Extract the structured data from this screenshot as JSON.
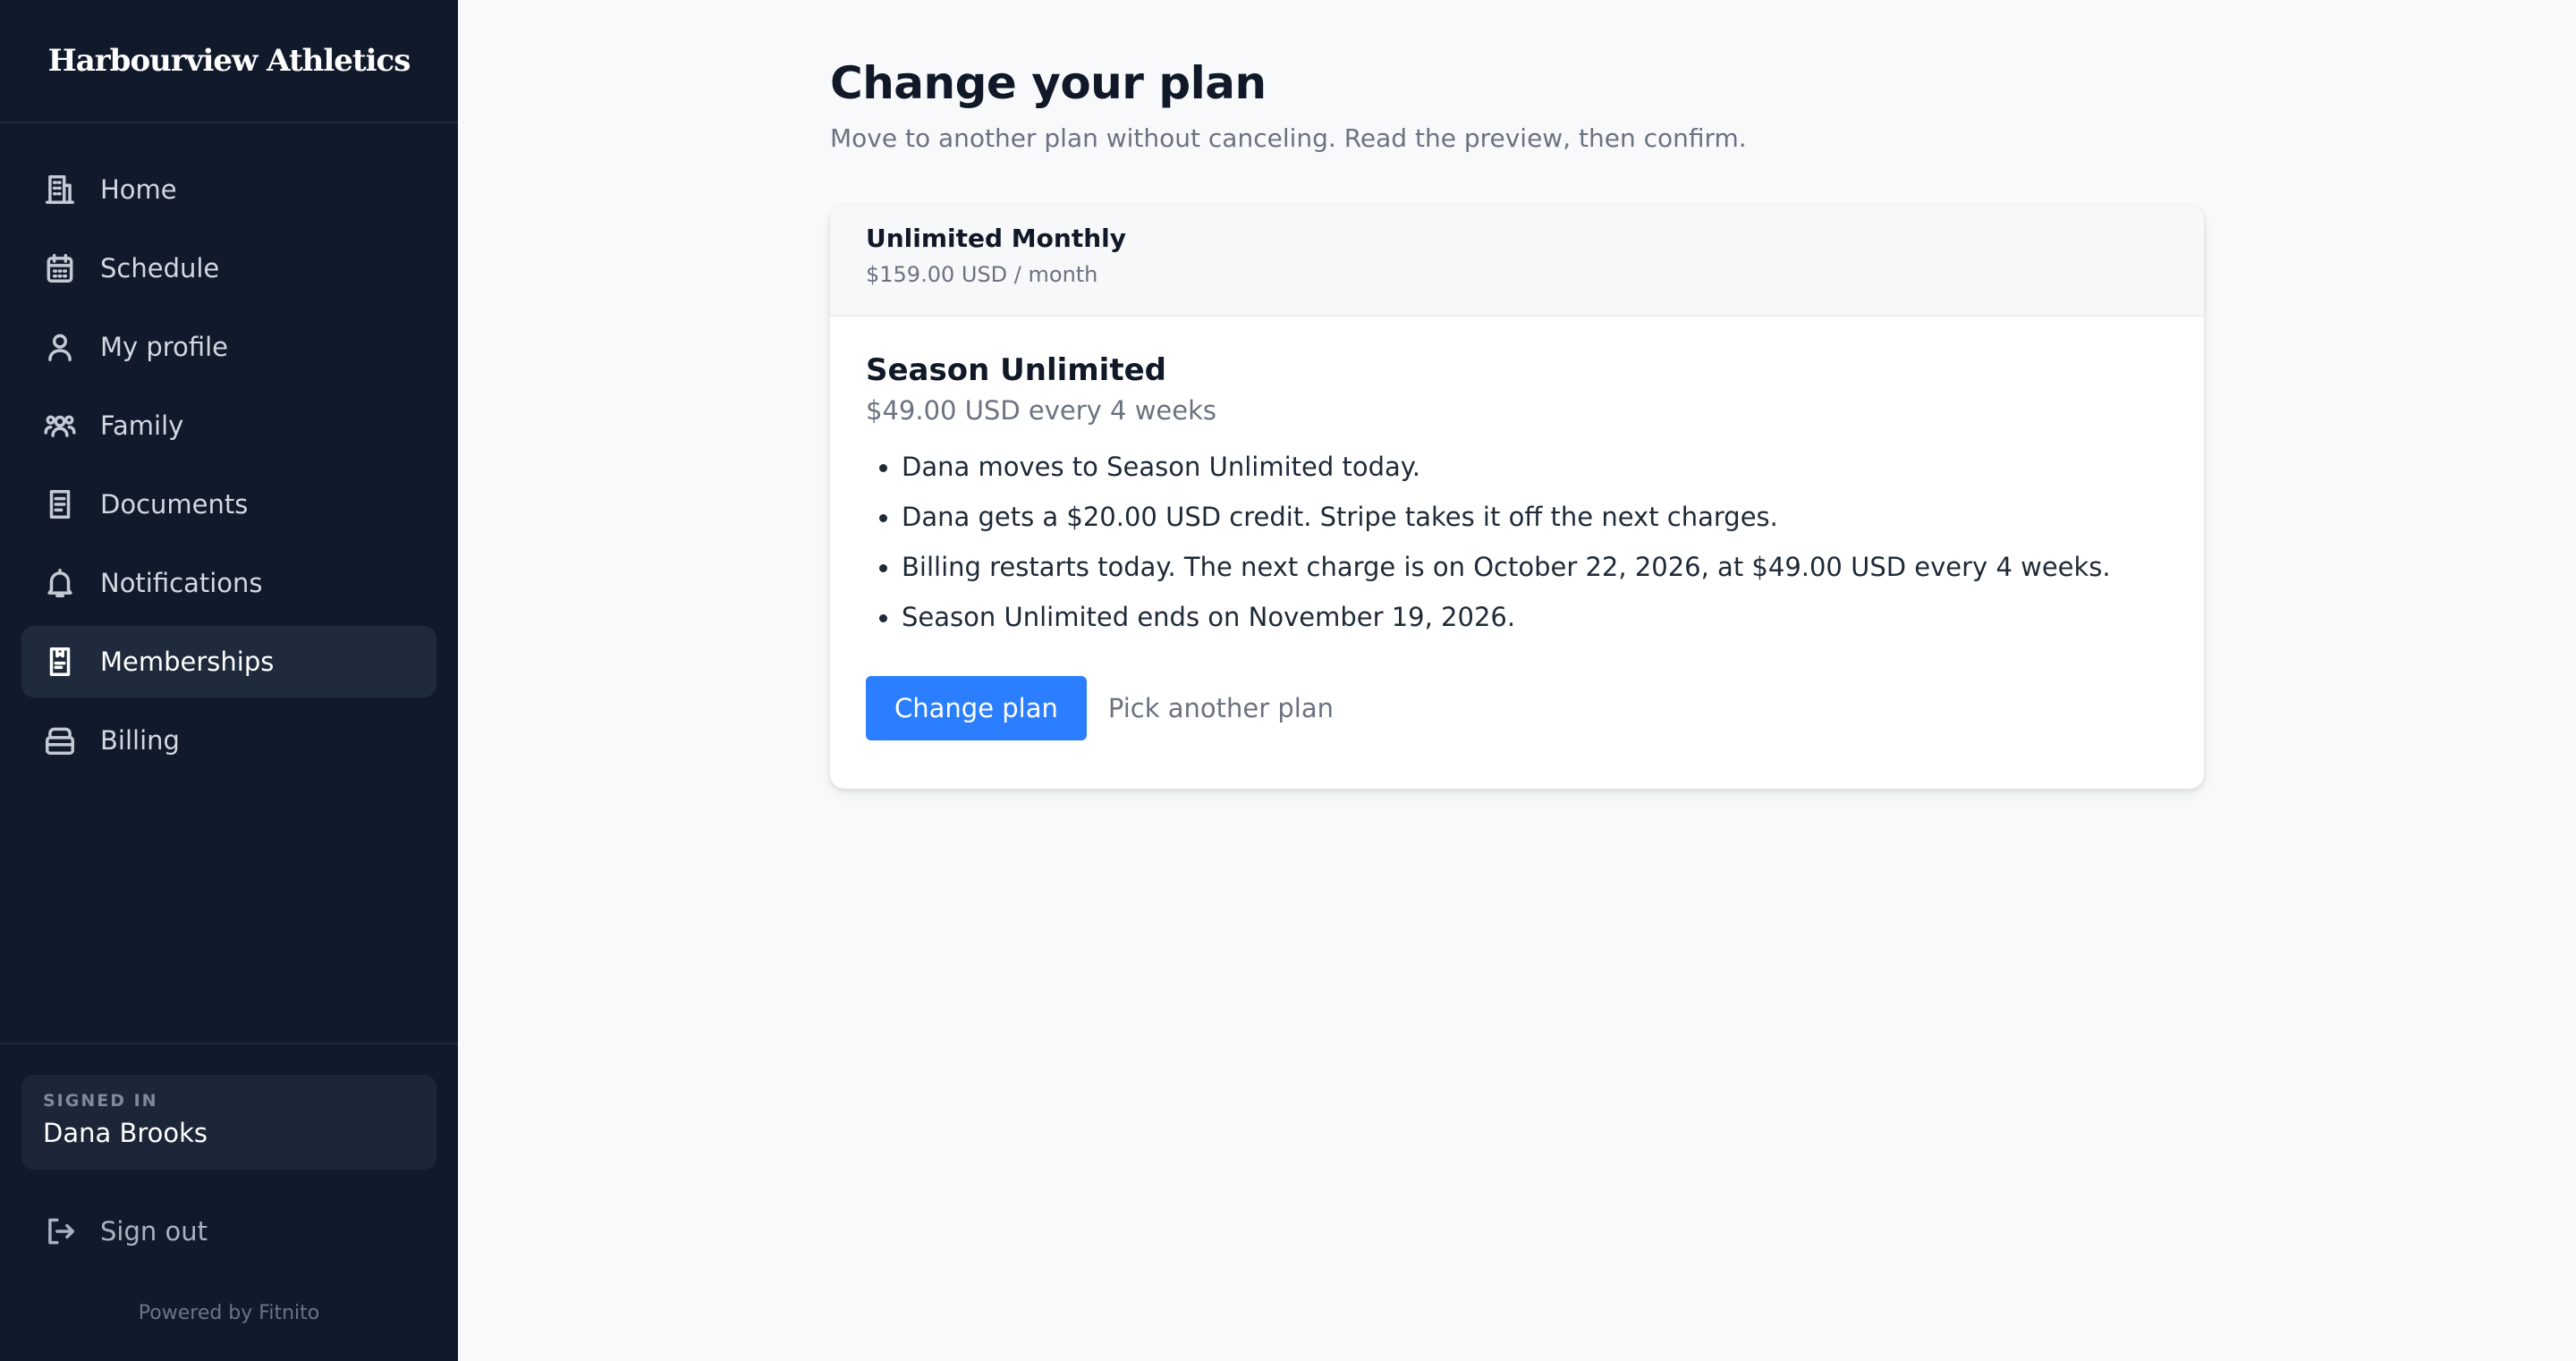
{
  "brand": {
    "name": "Harbourview Athletics"
  },
  "sidebar": {
    "items": [
      {
        "label": "Home",
        "icon": "building-icon",
        "active": false
      },
      {
        "label": "Schedule",
        "icon": "calendar-icon",
        "active": false
      },
      {
        "label": "My profile",
        "icon": "user-icon",
        "active": false
      },
      {
        "label": "Family",
        "icon": "users-icon",
        "active": false
      },
      {
        "label": "Documents",
        "icon": "document-icon",
        "active": false
      },
      {
        "label": "Notifications",
        "icon": "bell-icon",
        "active": false
      },
      {
        "label": "Memberships",
        "icon": "clipboard-icon",
        "active": true
      },
      {
        "label": "Billing",
        "icon": "wallet-icon",
        "active": false
      }
    ],
    "signed_in_label": "SIGNED IN",
    "user_name": "Dana Brooks",
    "sign_out_label": "Sign out",
    "powered_by": "Powered by Fitnito"
  },
  "main": {
    "title": "Change your plan",
    "subtitle": "Move to another plan without canceling. Read the preview, then confirm.",
    "current_plan": {
      "name": "Unlimited Monthly",
      "price": "$159.00 USD / month"
    },
    "new_plan": {
      "name": "Season Unlimited",
      "price": "$49.00 USD every 4 weeks",
      "details": [
        "Dana moves to Season Unlimited today.",
        "Dana gets a $20.00 USD credit. Stripe takes it off the next charges.",
        "Billing restarts today. The next charge is on October 22, 2026, at $49.00 USD every 4 weeks.",
        "Season Unlimited ends on November 19, 2026."
      ]
    },
    "actions": {
      "confirm_label": "Change plan",
      "secondary_label": "Pick another plan"
    }
  },
  "colors": {
    "sidebar_bg": "#111a2b",
    "active_item_bg": "#1f2a3c",
    "accent": "#2b7fff",
    "page_bg": "#f8f9fb"
  }
}
